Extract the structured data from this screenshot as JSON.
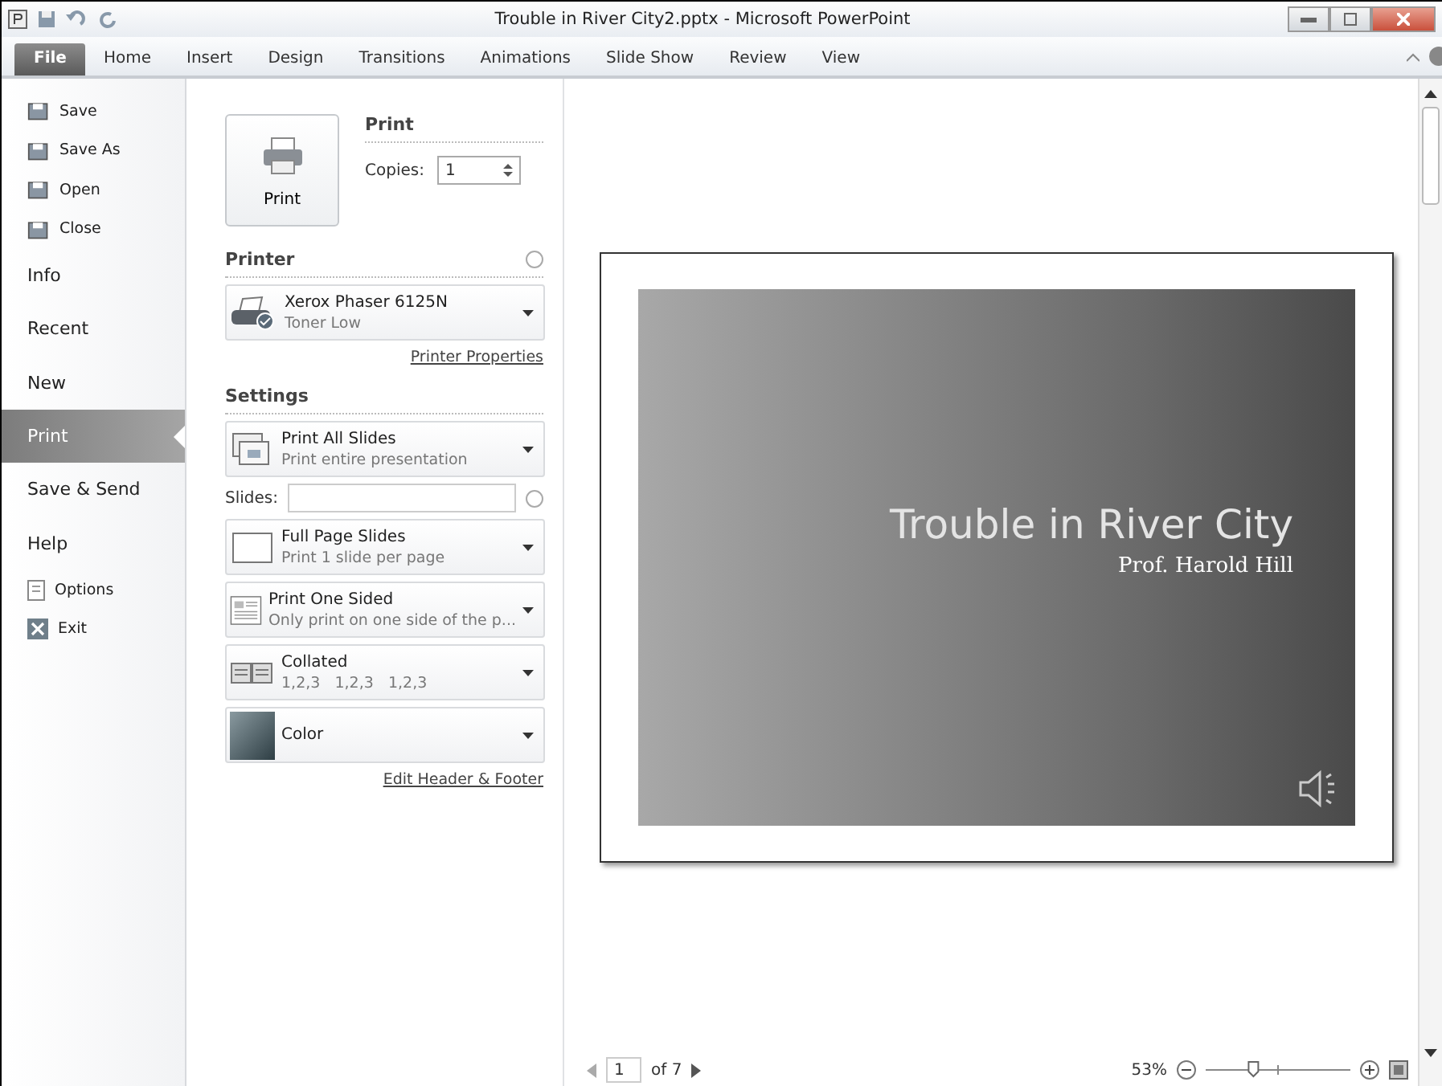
{
  "window": {
    "title": "Trouble in River City2.pptx - Microsoft PowerPoint"
  },
  "ribbon_tabs": [
    {
      "label": "File",
      "selected": true
    },
    {
      "label": "Home",
      "selected": false
    },
    {
      "label": "Insert",
      "selected": false
    },
    {
      "label": "Design",
      "selected": false
    },
    {
      "label": "Transitions",
      "selected": false
    },
    {
      "label": "Animations",
      "selected": false
    },
    {
      "label": "Slide Show",
      "selected": false
    },
    {
      "label": "Review",
      "selected": false
    },
    {
      "label": "View",
      "selected": false
    }
  ],
  "backstage_nav": [
    {
      "label": "Save",
      "kind": "command",
      "selected": false
    },
    {
      "label": "Save As",
      "kind": "command",
      "selected": false
    },
    {
      "label": "Open",
      "kind": "command",
      "selected": false
    },
    {
      "label": "Close",
      "kind": "command",
      "selected": false
    },
    {
      "label": "Info",
      "kind": "page",
      "selected": false
    },
    {
      "label": "Recent",
      "kind": "page",
      "selected": false
    },
    {
      "label": "New",
      "kind": "page",
      "selected": false
    },
    {
      "label": "Print",
      "kind": "page",
      "selected": true
    },
    {
      "label": "Save & Send",
      "kind": "page",
      "selected": false
    },
    {
      "label": "Help",
      "kind": "page",
      "selected": false
    },
    {
      "label": "Options",
      "kind": "command",
      "selected": false
    },
    {
      "label": "Exit",
      "kind": "command",
      "selected": false
    }
  ],
  "print_panel": {
    "print_button": "Print",
    "heading": "Print",
    "copies_label": "Copies:",
    "copies_value": "1",
    "printer_heading": "Printer",
    "printer": {
      "name": "Xerox Phaser 6125N",
      "status": "Toner Low"
    },
    "printer_properties_link": "Printer Properties",
    "settings_heading": "Settings",
    "settings": [
      {
        "kind": "slides",
        "title": "Print All Slides",
        "subtitle": "Print entire presentation"
      },
      {
        "kind": "layout",
        "title": "Full Page Slides",
        "subtitle": "Print 1 slide per page"
      },
      {
        "kind": "sides",
        "title": "Print One Sided",
        "subtitle": "Only print on one side of the p..."
      },
      {
        "kind": "collate",
        "title": "Collated",
        "subtitle": "1,2,3   1,2,3   1,2,3"
      },
      {
        "kind": "color",
        "title": "Color"
      }
    ],
    "slides_label": "Slides:",
    "edit_header_footer_link": "Edit Header & Footer"
  },
  "preview": {
    "slide_title": "Trouble in River City",
    "slide_subtitle": "Prof. Harold Hill",
    "page_number": "1",
    "page_total": "of 7",
    "zoom": "53%",
    "zoom_slider": {
      "level": 0.33
    }
  }
}
